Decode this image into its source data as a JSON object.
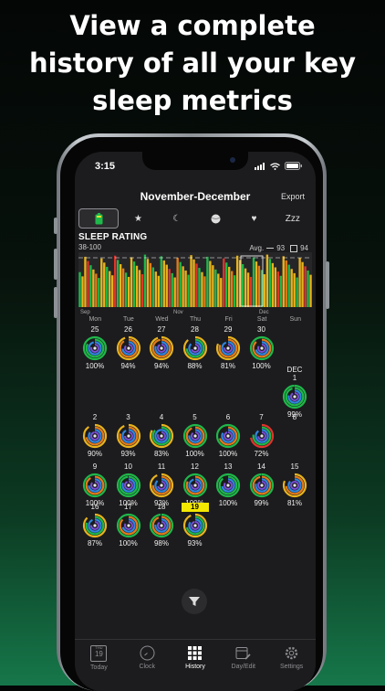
{
  "headline": [
    "View a complete",
    "history of all your key",
    "sleep metrics"
  ],
  "status_bar": {
    "time": "3:15"
  },
  "header": {
    "title": "November-December",
    "export_label": "Export"
  },
  "tabs": [
    {
      "name": "battery-icon",
      "glyph": "▮"
    },
    {
      "name": "star-icon",
      "glyph": "★"
    },
    {
      "name": "moon-icon",
      "glyph": "☾"
    },
    {
      "name": "ball-icon",
      "glyph": "●"
    },
    {
      "name": "heart-icon",
      "glyph": "♥"
    },
    {
      "name": "zzz-label",
      "glyph": "Zzz"
    }
  ],
  "metric": {
    "label": "SLEEP RATING",
    "range": "38-100",
    "avg_label": "Avg.",
    "avg_value": "93",
    "box_value": "94"
  },
  "chart_month_labels": {
    "left": "Sep",
    "mid": "Nov",
    "right": "Dec"
  },
  "weekdays": [
    "Mon",
    "Tue",
    "Wed",
    "Thu",
    "Fri",
    "Sat",
    "Sun"
  ],
  "month_label": "DEC",
  "calendar": [
    {
      "day": "25",
      "pct": "100%",
      "fill": 1.0
    },
    {
      "day": "26",
      "pct": "94%",
      "fill": 0.94
    },
    {
      "day": "27",
      "pct": "94%",
      "fill": 0.94
    },
    {
      "day": "28",
      "pct": "88%",
      "fill": 0.88
    },
    {
      "day": "29",
      "pct": "81%",
      "fill": 0.81
    },
    {
      "day": "30",
      "pct": "100%",
      "fill": 1.0
    },
    {
      "day": "1",
      "pct": "99%",
      "fill": 0.99
    },
    {
      "day": "2",
      "pct": "90%",
      "fill": 0.9
    },
    {
      "day": "3",
      "pct": "93%",
      "fill": 0.93
    },
    {
      "day": "4",
      "pct": "83%",
      "fill": 0.83
    },
    {
      "day": "5",
      "pct": "100%",
      "fill": 1.0
    },
    {
      "day": "6",
      "pct": "100%",
      "fill": 1.0
    },
    {
      "day": "7",
      "pct": "72%",
      "fill": 0.72
    },
    {
      "day": "8",
      "pct": "",
      "fill": 0
    },
    {
      "day": "9",
      "pct": "100%",
      "fill": 1.0
    },
    {
      "day": "10",
      "pct": "100%",
      "fill": 1.0
    },
    {
      "day": "11",
      "pct": "93%",
      "fill": 0.93
    },
    {
      "day": "12",
      "pct": "100%",
      "fill": 1.0
    },
    {
      "day": "13",
      "pct": "100%",
      "fill": 1.0
    },
    {
      "day": "14",
      "pct": "99%",
      "fill": 0.99
    },
    {
      "day": "15",
      "pct": "81%",
      "fill": 0.81
    },
    {
      "day": "16",
      "pct": "87%",
      "fill": 0.87
    },
    {
      "day": "17",
      "pct": "100%",
      "fill": 1.0
    },
    {
      "day": "18",
      "pct": "98%",
      "fill": 0.98
    },
    {
      "day": "19",
      "pct": "93%",
      "fill": 0.93
    }
  ],
  "tabbar": [
    {
      "label": "Today",
      "icon": "calendar-icon",
      "cal_month": "THU",
      "cal_day": "19"
    },
    {
      "label": "Clock",
      "icon": "clock-icon"
    },
    {
      "label": "History",
      "icon": "grid-icon"
    },
    {
      "label": "Day/Edit",
      "icon": "calendar-edit-icon"
    },
    {
      "label": "Settings",
      "icon": "gear-icon"
    }
  ],
  "colors": {
    "green": "#1fb84a",
    "yellow": "#e8b31e",
    "orange": "#e37b1a",
    "red": "#e0342c",
    "today": "#f3e800"
  }
}
